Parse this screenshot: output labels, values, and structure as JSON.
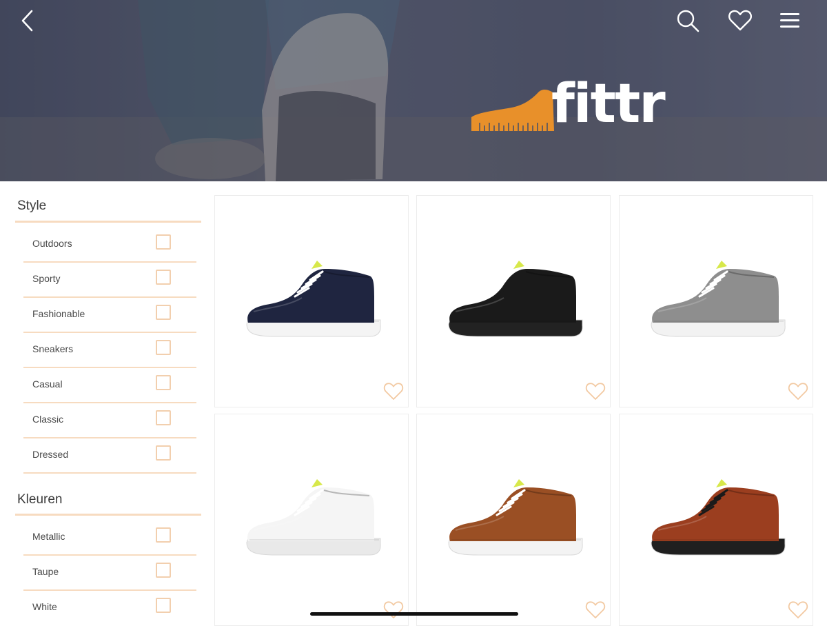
{
  "app": {
    "brand": "fittr",
    "accent_color": "#e8902a"
  },
  "header": {
    "icons": [
      "chevron-left-icon",
      "search-icon",
      "heart-icon",
      "hamburger-menu-icon"
    ]
  },
  "filters": {
    "style": {
      "title": "Style",
      "items": [
        {
          "label": "Outdoors",
          "checked": false
        },
        {
          "label": "Sporty",
          "checked": false
        },
        {
          "label": "Fashionable",
          "checked": false
        },
        {
          "label": "Sneakers",
          "checked": false
        },
        {
          "label": "Casual",
          "checked": false
        },
        {
          "label": "Classic",
          "checked": false
        },
        {
          "label": "Dressed",
          "checked": false
        }
      ]
    },
    "colors": {
      "title": "Kleuren",
      "items": [
        {
          "label": "Metallic",
          "checked": false
        },
        {
          "label": "Taupe",
          "checked": false
        },
        {
          "label": "White",
          "checked": false
        }
      ]
    }
  },
  "products": [
    {
      "color": "navy",
      "upper": "#1f2540",
      "sole": "#f4f4f4",
      "lace": "#ffffff",
      "favorited": false
    },
    {
      "color": "black",
      "upper": "#1a1a1a",
      "sole": "#222222",
      "lace": "#1a1a1a",
      "favorited": false
    },
    {
      "color": "grey",
      "upper": "#8e8e8e",
      "sole": "#f2f2f2",
      "lace": "#ffffff",
      "favorited": false
    },
    {
      "color": "white",
      "upper": "#f5f5f5",
      "sole": "#e9e9e9",
      "lace": "#ffffff",
      "favorited": false
    },
    {
      "color": "cognac-suede",
      "upper": "#9a4f24",
      "sole": "#f3f3f3",
      "lace": "#ffffff",
      "favorited": false
    },
    {
      "color": "cognac-leather",
      "upper": "#9b3e1f",
      "sole": "#1f1f1f",
      "lace": "#1a1a1a",
      "favorited": false
    }
  ]
}
